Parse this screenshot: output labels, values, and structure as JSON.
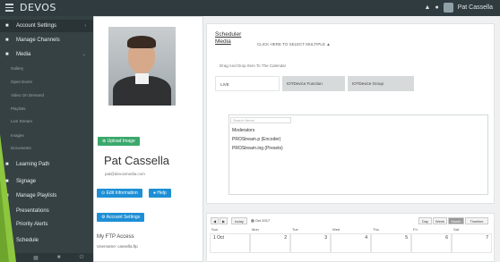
{
  "topbar": {
    "logo": "DEVOS",
    "user": "Pat Cassella"
  },
  "sidebar": {
    "items": [
      {
        "label": "Account Settings",
        "icon": "gear-icon"
      },
      {
        "label": "Manage Channels",
        "icon": "channels-icon"
      },
      {
        "label": "Media",
        "icon": "media-icon"
      },
      {
        "label": "Gallery",
        "sub": true
      },
      {
        "label": "Open Event",
        "sub": true
      },
      {
        "label": "Video On Demand",
        "sub": true
      },
      {
        "label": "Playlists",
        "sub": true
      },
      {
        "label": "Live Stream",
        "sub": true
      },
      {
        "label": "Images",
        "sub": true
      },
      {
        "label": "Documents",
        "sub": true
      },
      {
        "label": "Learning Path",
        "icon": "learning-icon"
      },
      {
        "label": "Signage",
        "icon": "signage-icon"
      },
      {
        "label": "Manage Playlists",
        "icon": "playlist-icon"
      },
      {
        "label": "Presentations",
        "icon": "presentation-icon"
      },
      {
        "label": "Priority Alerts",
        "icon": "alert-icon"
      },
      {
        "label": "Schedule",
        "icon": "calendar-icon"
      }
    ]
  },
  "profile": {
    "upload_label": "Upload Image",
    "name": "Pat Cassella",
    "email": "pat@devosmedia.com",
    "edit_label": "Edit Information",
    "help_label": "Help",
    "account_label": "Account Settings",
    "ftp_title": "My FTP Access",
    "ftp_user": "Username: cassella.ftp"
  },
  "scheduler": {
    "title_line1": "Scheduler",
    "title_line2": "Media",
    "subtitle": "CLICK HERE TO SELECT MULTIPLE ▲",
    "drag_hint": "Drag And Drop Item To The Calendar",
    "tabs": [
      "LIVE",
      "IOTDevice Function",
      "IOTDevice Group"
    ],
    "search_placeholder": "Search Items",
    "list_items": [
      "Moderators",
      "PROStream.p (Encoder)",
      "PROStream.ing (Presets)"
    ]
  },
  "calendar": {
    "today": "today",
    "month_label": "Oct 2017",
    "views": [
      "Day",
      "Week",
      "Month",
      "Timeline"
    ],
    "days": [
      "Sun",
      "Mon",
      "Tue",
      "Wed",
      "Thu",
      "Fri",
      "Sat"
    ],
    "dates": [
      "1 Oct",
      "2",
      "3",
      "4",
      "5",
      "6",
      "7"
    ]
  }
}
